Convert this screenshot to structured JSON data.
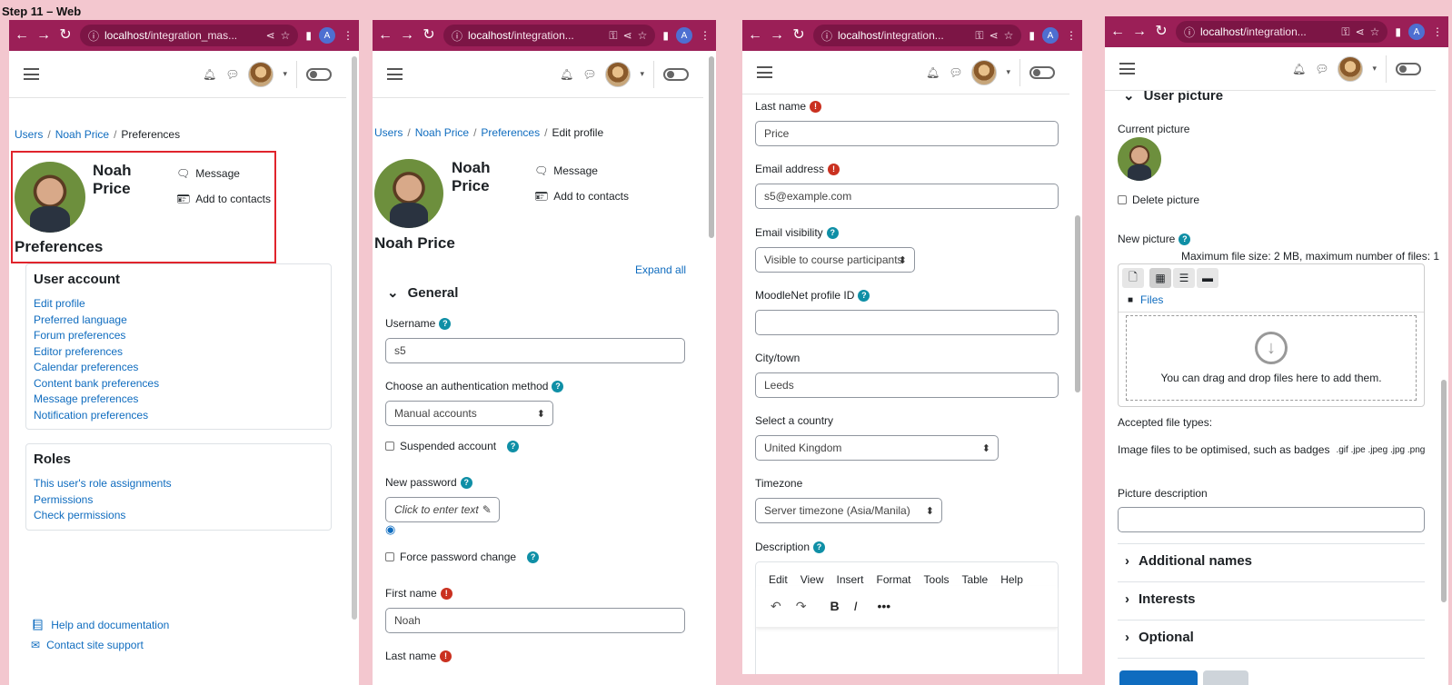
{
  "step_title": "Step 11 – Web",
  "browser": {
    "url_host": "localhost",
    "avatar_letter": "A"
  },
  "panes": [
    {
      "url_path": "/integration_mas..."
    },
    {
      "url_path": "/integration..."
    },
    {
      "url_path": "/integration..."
    },
    {
      "url_path": "/integration..."
    }
  ],
  "p1": {
    "breadcrumb": [
      "Users",
      "Noah Price",
      "Preferences"
    ],
    "name_first": "Noah",
    "name_last": "Price",
    "message": "Message",
    "add_contacts": "Add to contacts",
    "page_title": "Preferences",
    "user_account": {
      "title": "User account",
      "links": [
        "Edit profile",
        "Preferred language",
        "Forum preferences",
        "Editor preferences",
        "Calendar preferences",
        "Content bank preferences",
        "Message preferences",
        "Notification preferences"
      ]
    },
    "roles": {
      "title": "Roles",
      "links": [
        "This user's role assignments",
        "Permissions",
        "Check permissions"
      ]
    },
    "footer": {
      "help": "Help and documentation",
      "support": "Contact site support"
    }
  },
  "p2": {
    "breadcrumb": [
      "Users",
      "Noah Price",
      "Preferences",
      "Edit profile"
    ],
    "name_first": "Noah",
    "name_last": "Price",
    "message": "Message",
    "add_contacts": "Add to contacts",
    "page_title": "Noah Price",
    "expand_all": "Expand all",
    "general": "General",
    "username_label": "Username",
    "username_value": "s5",
    "auth_label": "Choose an authentication method",
    "auth_value": "Manual accounts",
    "suspended": "Suspended account",
    "newpass_label": "New password",
    "newpass_placeholder": "Click to enter text",
    "force_change": "Force password change",
    "firstname_label": "First name",
    "firstname_value": "Noah",
    "lastname_label": "Last name"
  },
  "p3": {
    "lastname_label": "Last name",
    "lastname_value": "Price",
    "email_label": "Email address",
    "email_value": "s5@example.com",
    "visibility_label": "Email visibility",
    "visibility_value": "Visible to course participants",
    "moodlenet_label": "MoodleNet profile ID",
    "moodlenet_value": "",
    "city_label": "City/town",
    "city_value": "Leeds",
    "country_label": "Select a country",
    "country_value": "United Kingdom",
    "timezone_label": "Timezone",
    "timezone_value": "Server timezone (Asia/Manila)",
    "description_label": "Description",
    "editor_menu": [
      "Edit",
      "View",
      "Insert",
      "Format",
      "Tools",
      "Table",
      "Help"
    ]
  },
  "p4": {
    "user_picture": "User picture",
    "current_picture": "Current picture",
    "delete_picture": "Delete picture",
    "new_picture": "New picture",
    "max_size": "Maximum file size: 2 MB, maximum number of files: 1",
    "files": "Files",
    "drop_text": "You can drag and drop files here to add them.",
    "accepted": "Accepted file types:",
    "image_files": "Image files to be optimised, such as badges",
    "extensions": ".gif .jpe .jpeg .jpg .png",
    "picture_desc": "Picture description",
    "additional_names": "Additional names",
    "interests": "Interests",
    "optional": "Optional"
  }
}
